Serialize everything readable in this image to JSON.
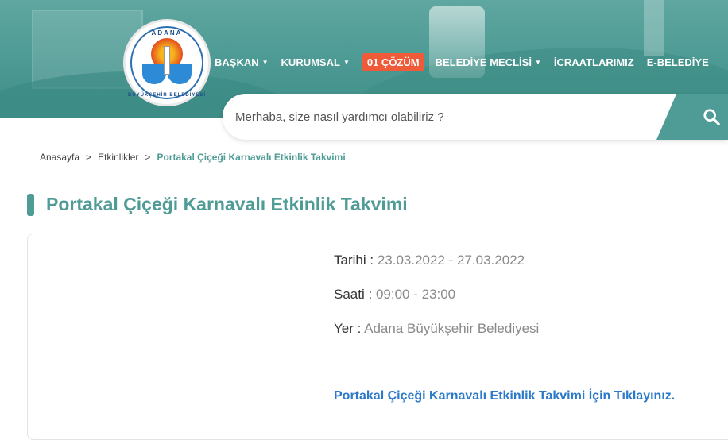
{
  "logo": {
    "top_text": "ADANA",
    "bottom_text": "BÜYÜKŞEHİR BELEDİYESİ"
  },
  "nav": {
    "items": [
      {
        "label": "BAŞKAN",
        "has_dropdown": true
      },
      {
        "label": "KURUMSAL",
        "has_dropdown": true
      },
      {
        "label": "01 ÇÖZÜM",
        "has_dropdown": false
      },
      {
        "label": "BELEDİYE MECLİSİ",
        "has_dropdown": true
      },
      {
        "label": "İCRAATLARIMIZ",
        "has_dropdown": false
      },
      {
        "label": "E-BELEDİYE",
        "has_dropdown": false
      }
    ],
    "highlight_color": "#ef5a38"
  },
  "search": {
    "placeholder": "Merhaba, size nasıl yardımcı olabiliriz ?",
    "icon": "search-icon"
  },
  "breadcrumb": {
    "items": [
      "Anasayfa",
      "Etkinlikler"
    ],
    "separator": ">",
    "current": "Portakal Çiçeği Karnavalı Etkinlik Takvimi"
  },
  "page": {
    "title": "Portakal Çiçeği Karnavalı Etkinlik Takvimi"
  },
  "event": {
    "date_label": "Tarihi :",
    "date_value": "23.03.2022 - 27.03.2022",
    "time_label": "Saati :",
    "time_value": "09:00 - 23:00",
    "place_label": "Yer :",
    "place_value": "Adana Büyükşehir Belediyesi",
    "link_text": "Portakal Çiçeği Karnavalı Etkinlik Takvimi İçin Tıklayınız."
  },
  "colors": {
    "brand": "#4f9b95",
    "link": "#2b79c8"
  }
}
